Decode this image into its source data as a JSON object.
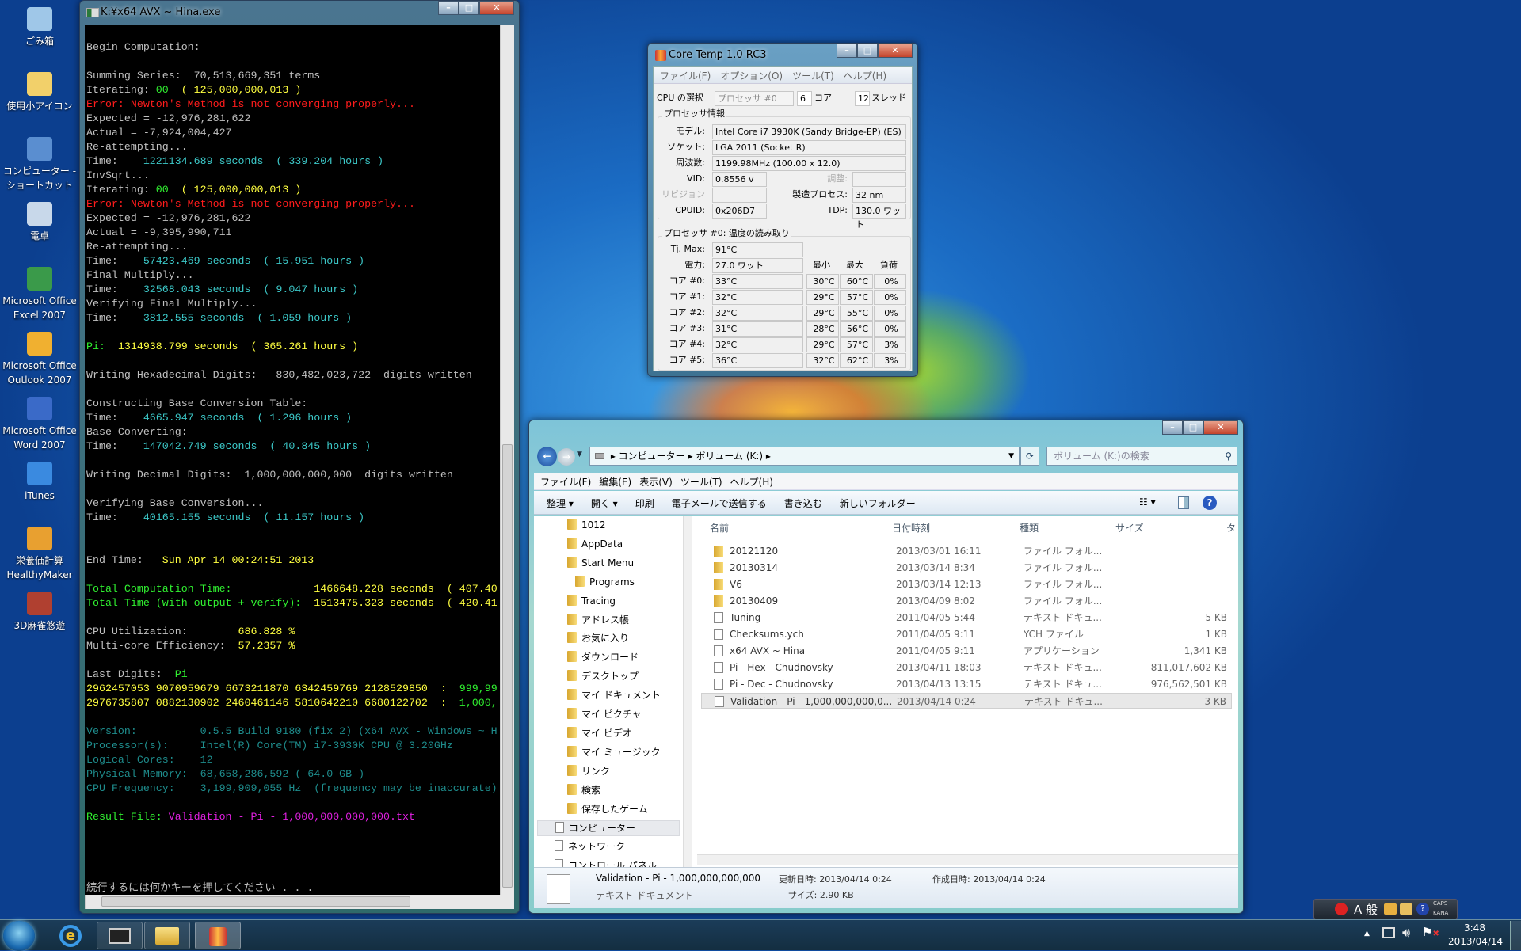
{
  "desktop": {
    "icons": [
      {
        "label": [
          "ごみ箱"
        ],
        "icon": "recycle-bin-icon",
        "color": "#9fc7e8"
      },
      {
        "label": [
          "使用小アイコン"
        ],
        "icon": "folder-icon",
        "color": "#f2d06a"
      },
      {
        "label": [
          "コンピューター -",
          "ショートカット"
        ],
        "icon": "computer-icon",
        "color": "#5a8ed0"
      },
      {
        "label": [
          "電卓"
        ],
        "icon": "calculator-icon",
        "color": "#c8d8ea"
      },
      {
        "label": [
          "Microsoft Office",
          "Excel 2007"
        ],
        "icon": "excel-icon",
        "color": "#3a9a4a"
      },
      {
        "label": [
          "Microsoft Office",
          "Outlook 2007"
        ],
        "icon": "outlook-icon",
        "color": "#f0b030"
      },
      {
        "label": [
          "Microsoft Office",
          "Word 2007"
        ],
        "icon": "word-icon",
        "color": "#3a6ac8"
      },
      {
        "label": [
          "iTunes"
        ],
        "icon": "itunes-icon",
        "color": "#3a8ae0"
      },
      {
        "label": [
          "栄養価計算",
          "HealthyMaker"
        ],
        "icon": "healthymaker-icon",
        "color": "#e8a030"
      },
      {
        "label": [
          "3D麻雀悠遊"
        ],
        "icon": "mahjong-icon",
        "color": "#b04030"
      }
    ]
  },
  "console": {
    "title": "K:¥x64 AVX ~ Hina.exe",
    "colors": {
      "w": "#c0c0c0",
      "c": "#3cc8c8",
      "y": "#ffff40",
      "r": "#ff1c1c",
      "g": "#30f030",
      "d": "#1e8c8c",
      "m": "#e020e0"
    },
    "lines": [
      [
        {
          "t": "Begin Computation:",
          "c": "w"
        }
      ],
      [],
      [
        {
          "t": "Summing Series:  70,513,669,351 terms",
          "c": "w"
        }
      ],
      [
        {
          "t": "Iterating: ",
          "c": "w"
        },
        {
          "t": "00",
          "c": "g"
        },
        {
          "t": "  ( 125,000,000,013 )",
          "c": "y"
        }
      ],
      [
        {
          "t": "Error: Newton's Method is not converging properly...",
          "c": "r"
        }
      ],
      [
        {
          "t": "Expected = -12,976,281,622",
          "c": "w"
        }
      ],
      [
        {
          "t": "Actual = -7,924,004,427",
          "c": "w"
        }
      ],
      [
        {
          "t": "Re-attempting...",
          "c": "w"
        }
      ],
      [
        {
          "t": "Time:    ",
          "c": "w"
        },
        {
          "t": "1221134.689 seconds  ( 339.204 hours )",
          "c": "c"
        }
      ],
      [
        {
          "t": "InvSqrt...",
          "c": "w"
        }
      ],
      [
        {
          "t": "Iterating: ",
          "c": "w"
        },
        {
          "t": "00",
          "c": "g"
        },
        {
          "t": "  ( 125,000,000,013 )",
          "c": "y"
        }
      ],
      [
        {
          "t": "Error: Newton's Method is not converging properly...",
          "c": "r"
        }
      ],
      [
        {
          "t": "Expected = -12,976,281,622",
          "c": "w"
        }
      ],
      [
        {
          "t": "Actual = -9,395,990,711",
          "c": "w"
        }
      ],
      [
        {
          "t": "Re-attempting...",
          "c": "w"
        }
      ],
      [
        {
          "t": "Time:    ",
          "c": "w"
        },
        {
          "t": "57423.469 seconds  ( 15.951 hours )",
          "c": "c"
        }
      ],
      [
        {
          "t": "Final Multiply...",
          "c": "w"
        }
      ],
      [
        {
          "t": "Time:    ",
          "c": "w"
        },
        {
          "t": "32568.043 seconds  ( 9.047 hours )",
          "c": "c"
        }
      ],
      [
        {
          "t": "Verifying Final Multiply...",
          "c": "w"
        }
      ],
      [
        {
          "t": "Time:    ",
          "c": "w"
        },
        {
          "t": "3812.555 seconds  ( 1.059 hours )",
          "c": "c"
        }
      ],
      [],
      [
        {
          "t": "Pi:  ",
          "c": "g"
        },
        {
          "t": "1314938.799 seconds  ( 365.261 hours )",
          "c": "y"
        }
      ],
      [],
      [
        {
          "t": "Writing Hexadecimal Digits:   830,482,023,722  digits written",
          "c": "w"
        }
      ],
      [],
      [
        {
          "t": "Constructing Base Conversion Table:",
          "c": "w"
        }
      ],
      [
        {
          "t": "Time:    ",
          "c": "w"
        },
        {
          "t": "4665.947 seconds  ( 1.296 hours )",
          "c": "c"
        }
      ],
      [
        {
          "t": "Base Converting:",
          "c": "w"
        }
      ],
      [
        {
          "t": "Time:    ",
          "c": "w"
        },
        {
          "t": "147042.749 seconds  ( 40.845 hours )",
          "c": "c"
        }
      ],
      [],
      [
        {
          "t": "Writing Decimal Digits:  1,000,000,000,000  digits written",
          "c": "w"
        }
      ],
      [],
      [
        {
          "t": "Verifying Base Conversion...",
          "c": "w"
        }
      ],
      [
        {
          "t": "Time:    ",
          "c": "w"
        },
        {
          "t": "40165.155 seconds  ( 11.157 hours )",
          "c": "c"
        }
      ],
      [],
      [],
      [
        {
          "t": "End Time:   ",
          "c": "w"
        },
        {
          "t": "Sun Apr 14 00:24:51 2013",
          "c": "y"
        }
      ],
      [],
      [
        {
          "t": "Total Computation Time:             ",
          "c": "g"
        },
        {
          "t": "1466648.228 seconds  ( 407.40",
          "c": "y"
        }
      ],
      [
        {
          "t": "Total Time (with output + verify):  ",
          "c": "g"
        },
        {
          "t": "1513475.323 seconds  ( 420.41",
          "c": "y"
        }
      ],
      [],
      [
        {
          "t": "CPU Utilization:        ",
          "c": "w"
        },
        {
          "t": "686.828 %",
          "c": "y"
        }
      ],
      [
        {
          "t": "Multi-core Efficiency:  ",
          "c": "w"
        },
        {
          "t": "57.2357 %",
          "c": "y"
        }
      ],
      [],
      [
        {
          "t": "Last Digits:  ",
          "c": "w"
        },
        {
          "t": "Pi",
          "c": "g"
        }
      ],
      [
        {
          "t": "2962457053 9070959679 6673211870 6342459769 2128529850  :  ",
          "c": "y"
        },
        {
          "t": "999,99",
          "c": "g"
        }
      ],
      [
        {
          "t": "2976735807 0882130902 2460461146 5810642210 6680122702  :  ",
          "c": "y"
        },
        {
          "t": "1,000,",
          "c": "g"
        }
      ],
      [],
      [
        {
          "t": "Version:          0.5.5 Build 9180 (fix 2) (x64 AVX - Windows ~ H",
          "c": "d"
        }
      ],
      [
        {
          "t": "Processor(s):     Intel(R) Core(TM) i7-3930K CPU @ 3.20GHz",
          "c": "d"
        }
      ],
      [
        {
          "t": "Logical Cores:    12",
          "c": "d"
        }
      ],
      [
        {
          "t": "Physical Memory:  68,658,286,592 ( 64.0 GB )",
          "c": "d"
        }
      ],
      [
        {
          "t": "CPU Frequency:    3,199,909,055 Hz  (frequency may be inaccurate)",
          "c": "d"
        }
      ],
      [],
      [
        {
          "t": "Result File: ",
          "c": "g"
        },
        {
          "t": "Validation - Pi - 1,000,000,000,000.txt",
          "c": "m"
        }
      ],
      [],
      [],
      [],
      [],
      [
        {
          "t": "続行するには何かキーを押してください . . .",
          "c": "w"
        }
      ]
    ]
  },
  "coretemp": {
    "title": "Core Temp 1.0 RC3",
    "menu": [
      "ファイル(F)",
      "オプション(O)",
      "ツール(T)",
      "ヘルプ(H)"
    ],
    "cpu_select_label": "CPU の選択",
    "cpu_select_value": "プロセッサ #0",
    "cores": "6",
    "cores_label": "コア",
    "threads": "12",
    "threads_label": "スレッド",
    "proc_group": "プロセッサ情報",
    "model_label": "モデル:",
    "model": "Intel Core i7 3930K (Sandy Bridge-EP)  (ES)",
    "socket_label": "ソケット:",
    "socket": "LGA 2011 (Socket R)",
    "freq_label": "周波数:",
    "freq": "1199.98MHz (100.00 x 12.0)",
    "vid_label": "VID:",
    "vid": "0.8556 v",
    "adjust_label": "調整:",
    "revision_label": "リビジョン",
    "process_label": "製造プロセス:",
    "process": "32 nm",
    "cpuid_label": "CPUID:",
    "cpuid": "0x206D7",
    "tdp_label": "TDP:",
    "tdp": "130.0 ワット",
    "temp_group": "プロセッサ #0: 温度の読み取り",
    "tjmax_label": "Tj. Max:",
    "tjmax": "91°C",
    "power_label": "電力:",
    "power": "27.0 ワット",
    "col_min": "最小",
    "col_max": "最大",
    "col_load": "負荷",
    "cores_list": [
      {
        "label": "コア #0:",
        "temp": "33°C",
        "min": "30°C",
        "max": "60°C",
        "load": "0%"
      },
      {
        "label": "コア #1:",
        "temp": "32°C",
        "min": "29°C",
        "max": "57°C",
        "load": "0%"
      },
      {
        "label": "コア #2:",
        "temp": "32°C",
        "min": "29°C",
        "max": "55°C",
        "load": "0%"
      },
      {
        "label": "コア #3:",
        "temp": "31°C",
        "min": "28°C",
        "max": "56°C",
        "load": "0%"
      },
      {
        "label": "コア #4:",
        "temp": "32°C",
        "min": "29°C",
        "max": "57°C",
        "load": "3%"
      },
      {
        "label": "コア #5:",
        "temp": "36°C",
        "min": "32°C",
        "max": "62°C",
        "load": "3%"
      }
    ]
  },
  "explorer": {
    "breadcrumb": [
      "コンピューター",
      "ボリューム (K:)"
    ],
    "search_placeholder": "ボリューム (K:)の検索",
    "menu": [
      "ファイル(F)",
      "編集(E)",
      "表示(V)",
      "ツール(T)",
      "ヘルプ(H)"
    ],
    "toolbar": [
      "整理 ▾",
      "開く ▾",
      "印刷",
      "電子メールで送信する",
      "書き込む",
      "新しいフォルダー"
    ],
    "nav": [
      {
        "label": "1012",
        "indent": 1,
        "icon": "folder-icon"
      },
      {
        "label": "AppData",
        "indent": 1,
        "icon": "folder-icon"
      },
      {
        "label": "Start Menu",
        "indent": 1,
        "icon": "folder-icon"
      },
      {
        "label": "Programs",
        "indent": 2,
        "icon": "folder-icon"
      },
      {
        "label": "Tracing",
        "indent": 1,
        "icon": "folder-icon"
      },
      {
        "label": "アドレス帳",
        "indent": 1,
        "icon": "contacts-folder-icon"
      },
      {
        "label": "お気に入り",
        "indent": 1,
        "icon": "favorites-folder-icon"
      },
      {
        "label": "ダウンロード",
        "indent": 1,
        "icon": "downloads-folder-icon"
      },
      {
        "label": "デスクトップ",
        "indent": 1,
        "icon": "desktop-folder-icon"
      },
      {
        "label": "マイ ドキュメント",
        "indent": 1,
        "icon": "documents-folder-icon"
      },
      {
        "label": "マイ ピクチャ",
        "indent": 1,
        "icon": "pictures-folder-icon"
      },
      {
        "label": "マイ ビデオ",
        "indent": 1,
        "icon": "videos-folder-icon"
      },
      {
        "label": "マイ ミュージック",
        "indent": 1,
        "icon": "music-folder-icon"
      },
      {
        "label": "リンク",
        "indent": 1,
        "icon": "links-folder-icon"
      },
      {
        "label": "検索",
        "indent": 1,
        "icon": "searches-folder-icon"
      },
      {
        "label": "保存したゲーム",
        "indent": 1,
        "icon": "saved-games-folder-icon"
      },
      {
        "label": "コンピューター",
        "indent": 0,
        "icon": "computer-icon",
        "selected": true
      },
      {
        "label": "ネットワーク",
        "indent": 0,
        "icon": "network-icon"
      },
      {
        "label": "コントロール パネル",
        "indent": 0,
        "icon": "control-panel-icon"
      }
    ],
    "columns": [
      "名前",
      "日付時刻",
      "種類",
      "サイズ",
      "タ"
    ],
    "files": [
      {
        "name": "20121120",
        "date": "2013/03/01 16:11",
        "type": "ファイル フォル...",
        "size": "",
        "icon": "folder-icon"
      },
      {
        "name": "20130314",
        "date": "2013/03/14 8:34",
        "type": "ファイル フォル...",
        "size": "",
        "icon": "folder-icon"
      },
      {
        "name": "V6",
        "date": "2013/03/14 12:13",
        "type": "ファイル フォル...",
        "size": "",
        "icon": "folder-icon"
      },
      {
        "name": "20130409",
        "date": "2013/04/09 8:02",
        "type": "ファイル フォル...",
        "size": "",
        "icon": "folder-icon"
      },
      {
        "name": "Tuning",
        "date": "2011/04/05 5:44",
        "type": "テキスト ドキュ...",
        "size": "5 KB",
        "icon": "text-file-icon"
      },
      {
        "name": "Checksums.ych",
        "date": "2011/04/05 9:11",
        "type": "YCH ファイル",
        "size": "1 KB",
        "icon": "file-icon"
      },
      {
        "name": "x64 AVX ~ Hina",
        "date": "2011/04/05 9:11",
        "type": "アプリケーション",
        "size": "1,341 KB",
        "icon": "application-icon"
      },
      {
        "name": "Pi - Hex - Chudnovsky",
        "date": "2013/04/11 18:03",
        "type": "テキスト ドキュ...",
        "size": "811,017,602 KB",
        "icon": "text-file-icon"
      },
      {
        "name": "Pi - Dec - Chudnovsky",
        "date": "2013/04/13 13:15",
        "type": "テキスト ドキュ...",
        "size": "976,562,501 KB",
        "icon": "text-file-icon"
      },
      {
        "name": "Validation - Pi - 1,000,000,000,0...",
        "date": "2013/04/14 0:24",
        "type": "テキスト ドキュ...",
        "size": "3 KB",
        "icon": "text-file-icon",
        "selected": true
      }
    ],
    "details": {
      "name": "Validation - Pi - 1,000,000,000,000",
      "type": "テキスト ドキュメント",
      "modified": "更新日時: 2013/04/14 0:24",
      "created": "作成日時: 2013/04/14 0:24",
      "size": "サイズ: 2.90 KB"
    }
  },
  "taskbar": {
    "tasks": [
      "internet-explorer-icon",
      "console-task-icon",
      "explorer-task-icon",
      "coretemp-task-icon"
    ],
    "langbar": {
      "ime": "A 般",
      "caps": "CAPS",
      "kana": "KANA"
    },
    "time": "3:48",
    "date": "2013/04/14"
  }
}
